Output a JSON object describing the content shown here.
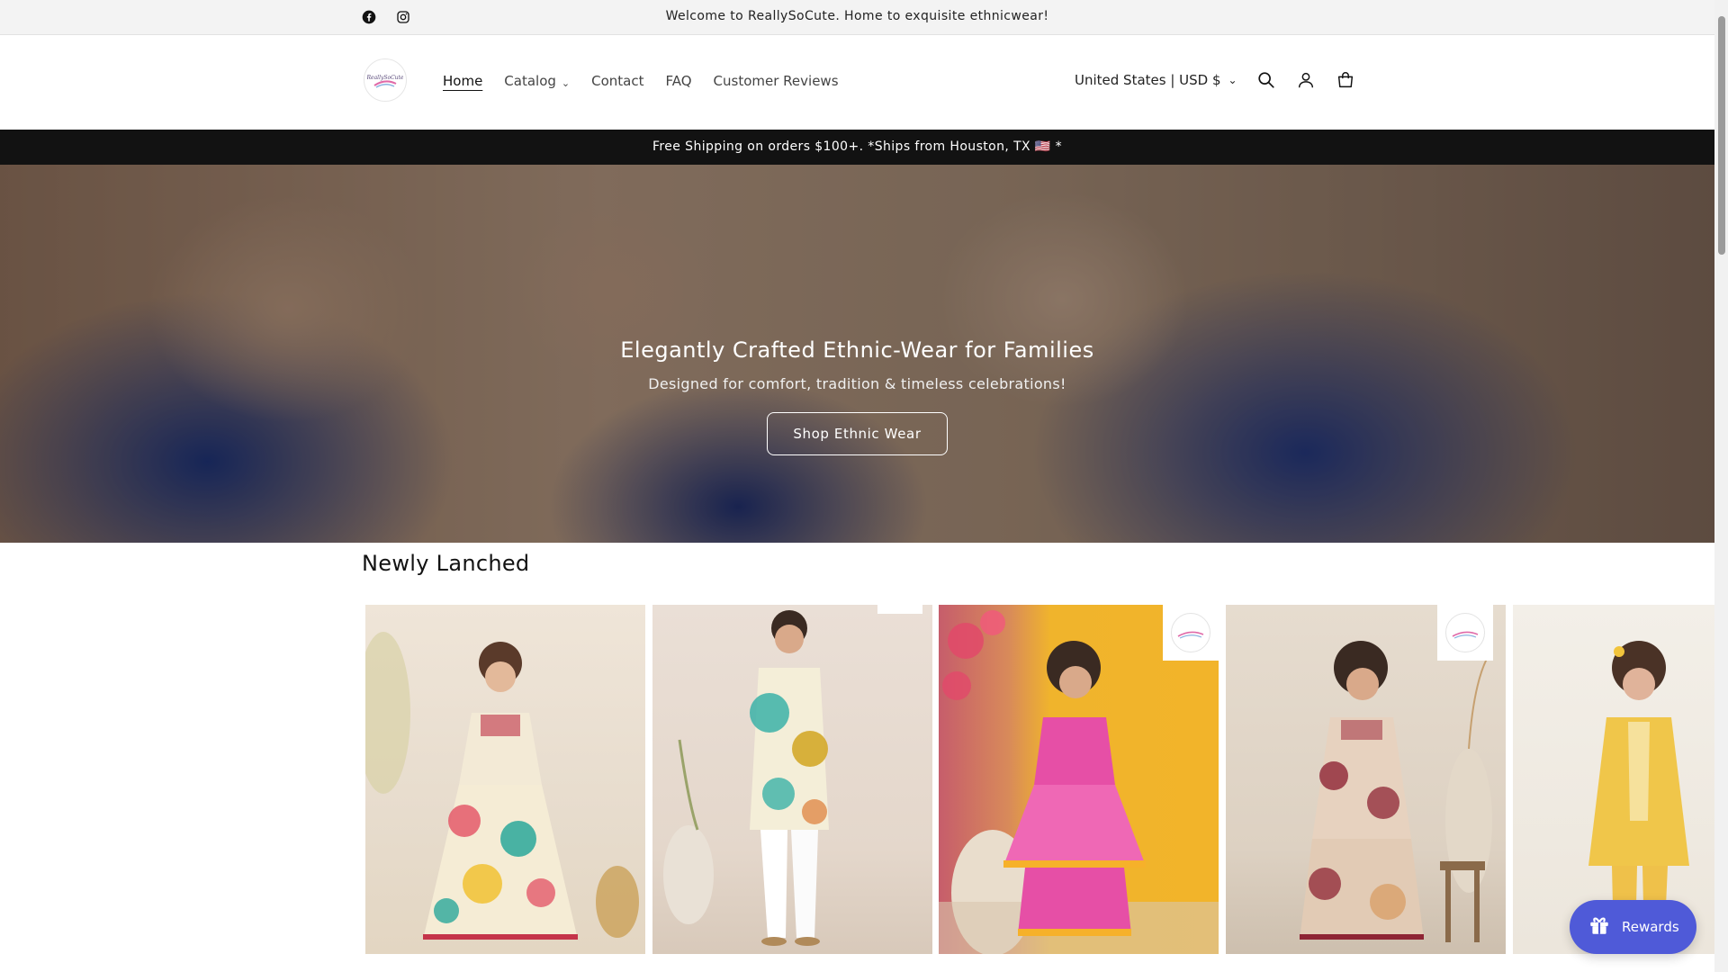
{
  "announcement": {
    "message": "Welcome to ReallySoCute. Home to exquisite ethnicwear!",
    "social": [
      "facebook-icon",
      "instagram-icon"
    ]
  },
  "header": {
    "logo_text": "ReallySoCute",
    "nav": [
      {
        "label": "Home",
        "active": true
      },
      {
        "label": "Catalog",
        "has_dropdown": true
      },
      {
        "label": "Contact"
      },
      {
        "label": "FAQ"
      },
      {
        "label": "Customer Reviews"
      }
    ],
    "country_selector": "United States | USD $",
    "icons": [
      "search-icon",
      "account-icon",
      "cart-icon"
    ]
  },
  "shipping_bar": {
    "message": "Free Shipping on orders $100+. *Ships from Houston, TX 🇺🇸 *"
  },
  "hero": {
    "title": "Elegantly Crafted Ethnic-Wear for Families",
    "subtitle": "Designed for comfort, tradition & timeless celebrations!",
    "button_label": "Shop Ethnic Wear"
  },
  "section": {
    "title": "Newly Lanched",
    "products": [
      {
        "description": "girl floral sharara set",
        "colors": [
          "#f0e6d8",
          "#e45a6a",
          "#2aa89a",
          "#f2c43c"
        ]
      },
      {
        "description": "boy floral kurta pajama",
        "colors": [
          "#f3ecd7",
          "#3bb2a8",
          "#d4a92a",
          "#ffffff"
        ]
      },
      {
        "description": "girl pink sharara set",
        "colors": [
          "#e64fa6",
          "#f6b12a",
          "#efe0c8"
        ]
      },
      {
        "description": "girl maroon floral sharara set",
        "colors": [
          "#e7d2bf",
          "#8e2434",
          "#d9a06a"
        ]
      },
      {
        "description": "girl yellow kurta set",
        "colors": [
          "#f0c64a",
          "#f7e7b0"
        ]
      }
    ]
  },
  "rewards": {
    "label": "Rewards"
  },
  "colors": {
    "announcement_bg": "#f3f3f3",
    "shipping_bg": "#121212",
    "rewards_bg": "#4f5ad8"
  }
}
